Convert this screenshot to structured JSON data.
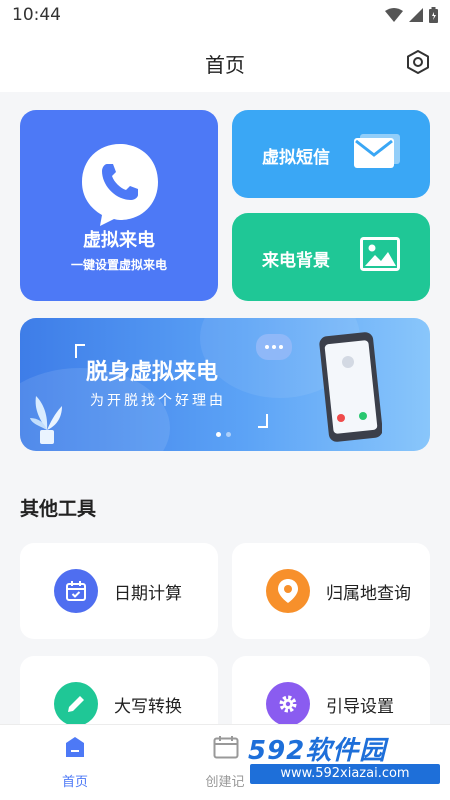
{
  "status_bar": {
    "time": "10:44"
  },
  "header": {
    "title": "首页"
  },
  "cards": {
    "virtual_call": {
      "title": "虚拟来电",
      "subtitle": "一键设置虚拟来电",
      "color": "#4d79f6"
    },
    "virtual_sms": {
      "label": "虚拟短信",
      "color": "#3aa7f5"
    },
    "call_background": {
      "label": "来电背景",
      "color": "#1fc796"
    }
  },
  "banner": {
    "title": "脱身虚拟来电",
    "subtitle": "为开脱找个好理由",
    "page_count": 2,
    "active_page": 1
  },
  "other_tools": {
    "title": "其他工具",
    "items": [
      {
        "label": "日期计算",
        "icon": "calendar-check-icon",
        "color": "#4f6ef0"
      },
      {
        "label": "归属地查询",
        "icon": "location-pin-icon",
        "color": "#f7902b"
      },
      {
        "label": "大写转换",
        "icon": "pencil-icon",
        "color": "#1fc796"
      },
      {
        "label": "引导设置",
        "icon": "gear-icon",
        "color": "#8a5cf0"
      }
    ]
  },
  "bottom_nav": {
    "items": [
      {
        "label": "首页",
        "icon": "home-icon",
        "active": true
      },
      {
        "label": "创建记",
        "icon": "calendar-icon",
        "active": false
      }
    ],
    "active_color": "#4d79f6",
    "inactive_color": "#999999"
  },
  "watermark": {
    "brand": "592软件园",
    "url": "www.592xiazai.com"
  }
}
